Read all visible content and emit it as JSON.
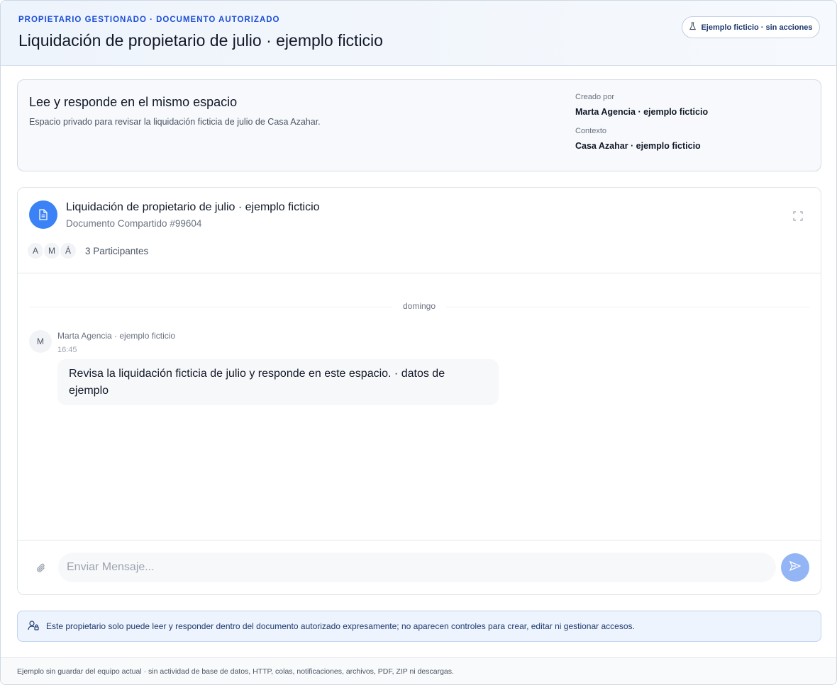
{
  "header": {
    "eyebrow": "PROPIETARIO GESTIONADO · DOCUMENTO AUTORIZADO",
    "title": "Liquidación de propietario de julio · ejemplo ficticio",
    "demo_badge": "Ejemplo ficticio · sin acciones",
    "demo_badge_icon": "flask-icon"
  },
  "intro": {
    "title": "Lee y responde en el mismo espacio",
    "description": "Espacio privado para revisar la liquidación ficticia de julio de Casa Azahar.",
    "created_by_label": "Creado por",
    "created_by_value": "Marta Agencia · ejemplo ficticio",
    "context_label": "Contexto",
    "context_value": "Casa Azahar · ejemplo ficticio"
  },
  "document": {
    "icon": "document-icon",
    "title": "Liquidación de propietario de julio · ejemplo ficticio",
    "subtitle": "Documento Compartido #99604",
    "expand_icon": "expand-icon",
    "participants": [
      "A",
      "M",
      "Á"
    ],
    "participants_count": "3 Participantes"
  },
  "conversation": {
    "day_label": "domingo",
    "messages": [
      {
        "avatar": "M",
        "author": "Marta Agencia · ejemplo ficticio",
        "time": "16:45",
        "text": "Revisa la liquidación ficticia de julio y responde en este espacio. · datos de ejemplo"
      }
    ]
  },
  "composer": {
    "placeholder": "Enviar Mensaje...",
    "value": "",
    "attach_icon": "paperclip-icon",
    "send_icon": "send-icon"
  },
  "notice": {
    "icon": "user-lock-icon",
    "text": "Este propietario solo puede leer y responder dentro del documento autorizado expresamente; no aparecen controles para crear, editar ni gestionar accesos."
  },
  "footer": {
    "text": "Ejemplo sin guardar del equipo actual · sin actividad de base de datos, HTTP, colas, notificaciones, archivos, PDF, ZIP ni descargas."
  },
  "colors": {
    "accent": "#1d4ed8",
    "doc_icon_bg": "#3b82f6",
    "send_button": "#93b4f5"
  }
}
